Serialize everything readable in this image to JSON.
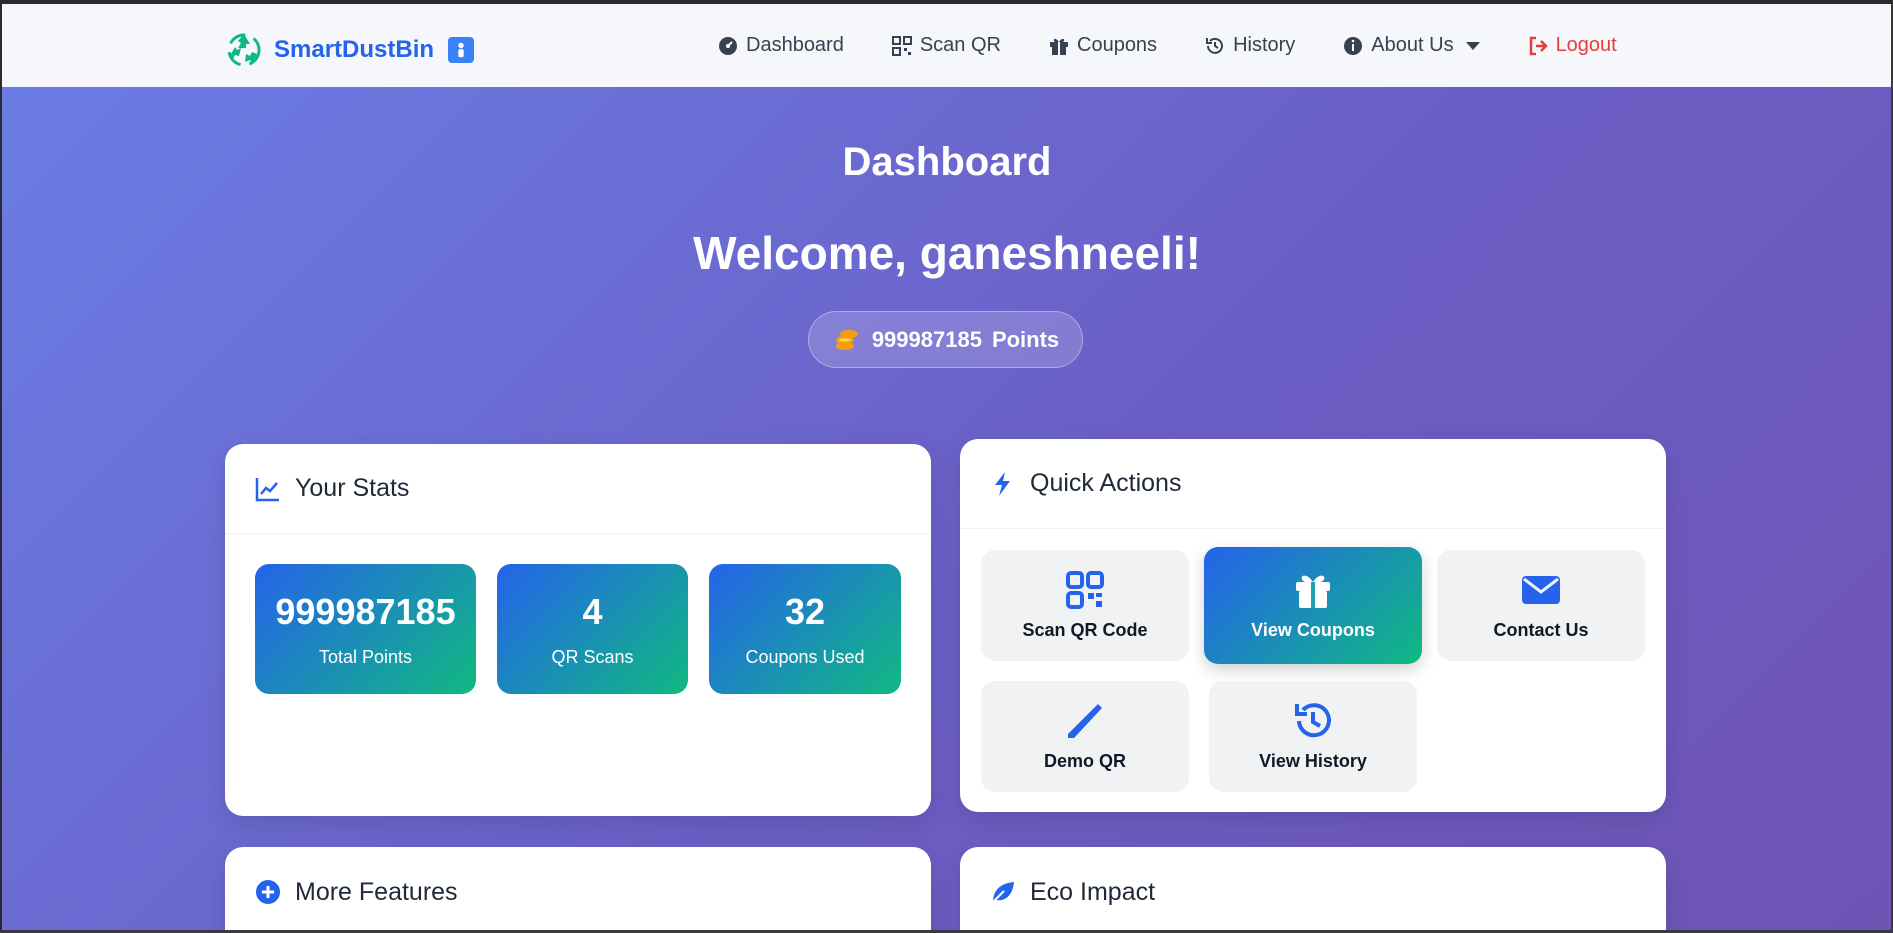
{
  "brand": {
    "name": "SmartDustBin",
    "badge_icon": "person-icon"
  },
  "nav": {
    "items": [
      {
        "label": "Dashboard",
        "icon": "gauge-icon"
      },
      {
        "label": "Scan QR",
        "icon": "qr-icon"
      },
      {
        "label": "Coupons",
        "icon": "gift-icon"
      },
      {
        "label": "History",
        "icon": "history-icon"
      },
      {
        "label": "About Us",
        "icon": "info-icon"
      }
    ],
    "logout": "Logout"
  },
  "page": {
    "title": "Dashboard",
    "welcome": "Welcome, ganeshneeli!",
    "points_value": "999987185",
    "points_label": "Points"
  },
  "stats_card": {
    "title": "Your Stats",
    "stats": [
      {
        "value": "999987185",
        "label": "Total Points"
      },
      {
        "value": "4",
        "label": "QR Scans"
      },
      {
        "value": "32",
        "label": "Coupons Used"
      }
    ]
  },
  "quick_actions": {
    "title": "Quick Actions",
    "actions": [
      {
        "label": "Scan QR Code",
        "icon": "qr-icon"
      },
      {
        "label": "View Coupons",
        "icon": "gift-icon"
      },
      {
        "label": "Contact Us",
        "icon": "envelope-icon"
      },
      {
        "label": "Demo QR",
        "icon": "wand-icon"
      },
      {
        "label": "View History",
        "icon": "history-icon"
      }
    ]
  },
  "more_features": {
    "title": "More Features"
  },
  "eco_impact": {
    "title": "Eco Impact"
  },
  "colors": {
    "brand_blue": "#2563eb",
    "accent_green": "#10b981",
    "logout_red": "#e53e3e",
    "coin_orange": "#f59e0b"
  }
}
